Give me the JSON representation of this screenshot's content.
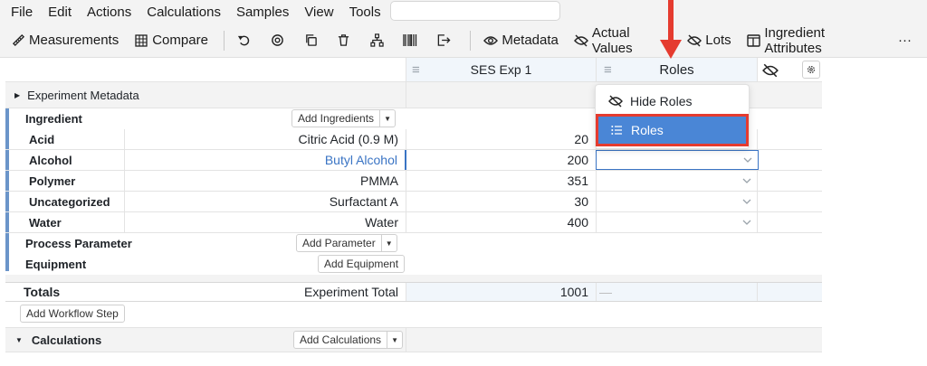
{
  "menu": [
    "File",
    "Edit",
    "Actions",
    "Calculations",
    "Samples",
    "View",
    "Tools"
  ],
  "search": {
    "placeholder": ""
  },
  "toolbar": {
    "measurements": "Measurements",
    "compare": "Compare",
    "metadata": "Metadata",
    "actual_values": "Actual Values",
    "lots": "Lots",
    "ingredient_attributes": "Ingredient Attributes",
    "more": "···"
  },
  "header": {
    "sample_col": "SES Exp 1",
    "roles_col": "Roles"
  },
  "experiment_metadata": "Experiment Metadata",
  "sections": {
    "ingredient": "Ingredient",
    "add_ingredients": "Add Ingredients",
    "process_parameter": "Process Parameter",
    "add_parameter": "Add Parameter",
    "equipment": "Equipment",
    "add_equipment": "Add Equipment"
  },
  "ingredients": [
    {
      "category": "Acid",
      "name": "Citric Acid (0.9 M)",
      "value": "20"
    },
    {
      "category": "Alcohol",
      "name": "Butyl Alcohol",
      "value": "200"
    },
    {
      "category": "Polymer",
      "name": "PMMA",
      "value": "351"
    },
    {
      "category": "Uncategorized",
      "name": "Surfactant A",
      "value": "30"
    },
    {
      "category": "Water",
      "name": "Water",
      "value": "400"
    }
  ],
  "totals": {
    "label": "Totals",
    "sublabel": "Experiment Total",
    "value": "1001",
    "dash": "—"
  },
  "workflow": {
    "add_step": "Add Workflow Step"
  },
  "calculations": {
    "label": "Calculations",
    "add": "Add Calculations"
  },
  "popup": {
    "hide_roles": "Hide Roles",
    "roles": "Roles"
  },
  "colors": {
    "accent": "#4a86d6",
    "highlight_border": "#e53b2f",
    "link_blue": "#3a74c4",
    "arrow_red": "#e53b2f"
  }
}
